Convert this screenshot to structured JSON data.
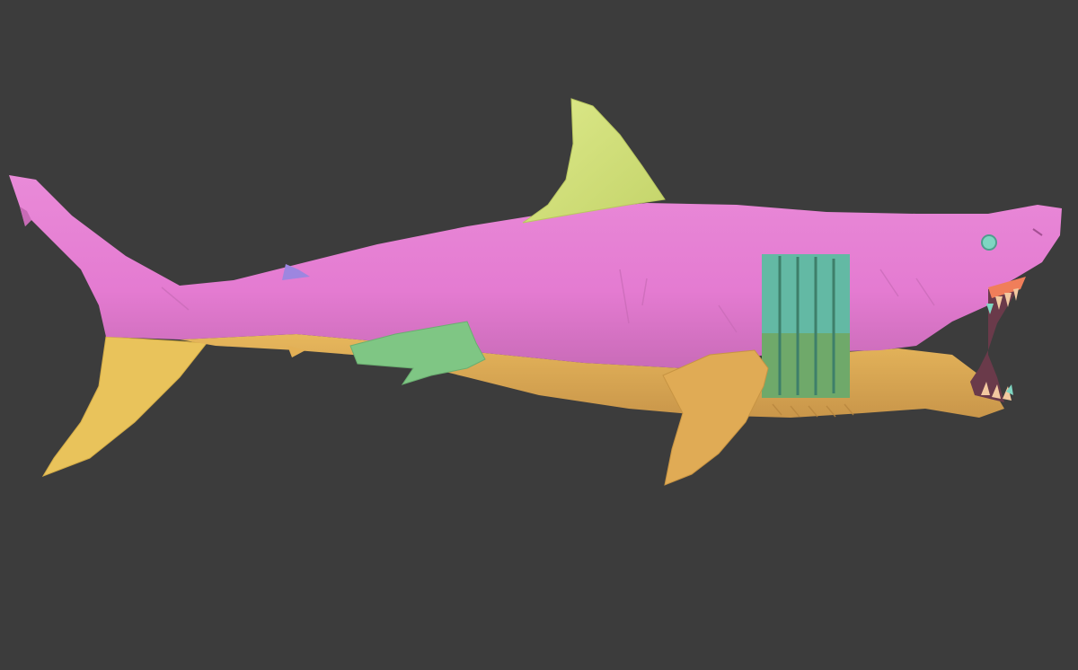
{
  "scene": {
    "background_color": "#3c3c3c",
    "subject": "shark-sculpt-polygroups",
    "polygroup_colors": {
      "upper_body": "#e57ad2",
      "belly": "#e3b055",
      "tail_lower_lobe": "#e8c35a",
      "dorsal_fin": "#d2e27a",
      "pectoral_and_pelvic_fin": "#7fc684",
      "gills_upper": "#63b9a4",
      "gills_lower": "#6fa96a",
      "second_dorsal_fin": "#9e86e0",
      "eye": "#7fd6c2",
      "teeth": "#f2c9a0",
      "gum": "#f07e5a"
    }
  }
}
